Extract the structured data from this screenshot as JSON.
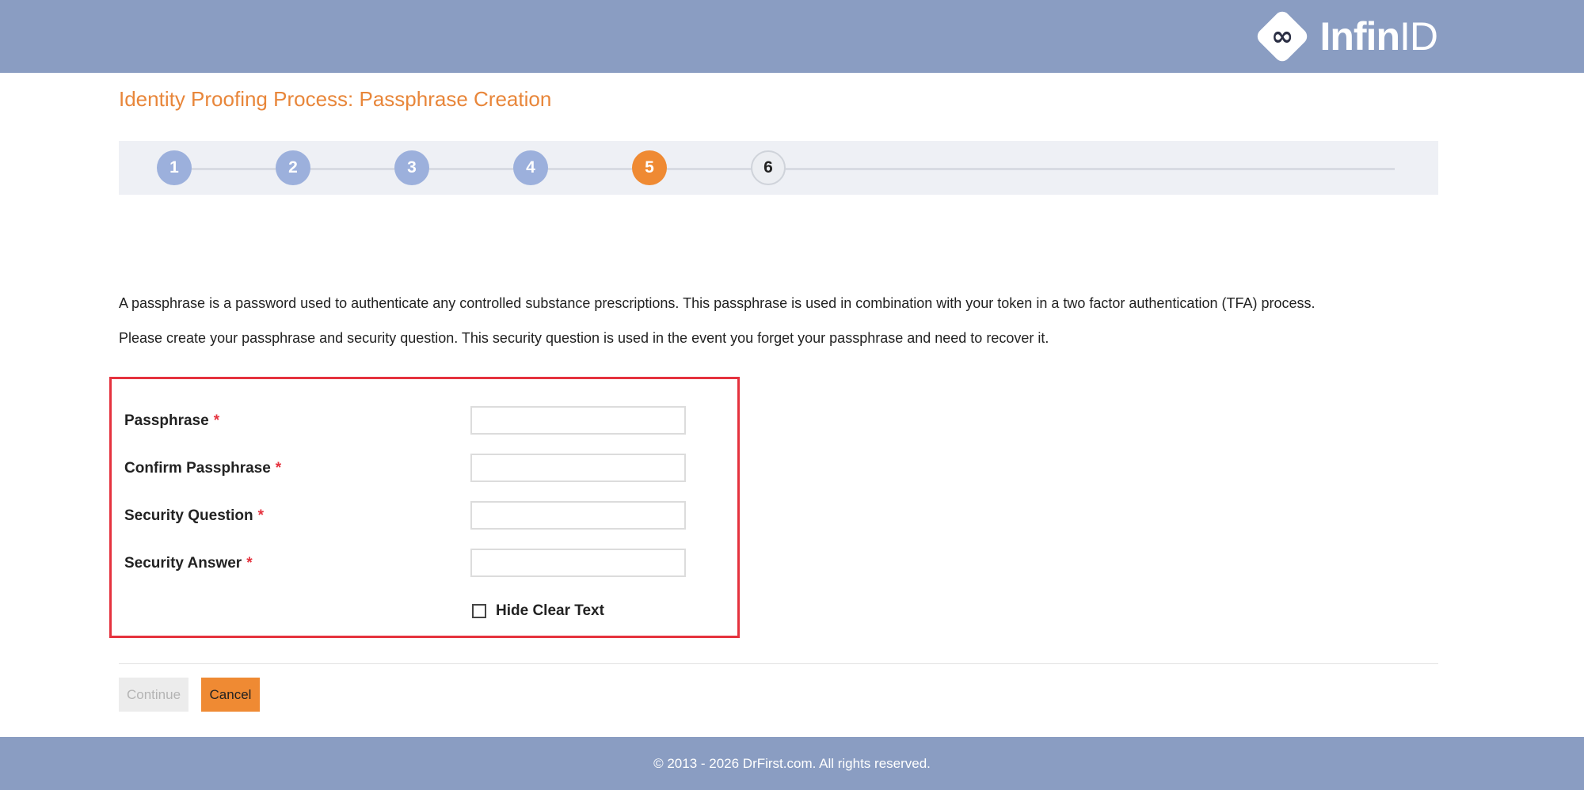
{
  "header": {
    "logo_icon": "infinity-icon",
    "logo_glyph": "∞",
    "logo_text_bold": "Infin",
    "logo_text_light": "ID",
    "bg_color": "#8a9dc2"
  },
  "page": {
    "title": "Identity Proofing Process: Passphrase Creation",
    "accent_color": "#e8863a"
  },
  "stepper": {
    "steps": [
      {
        "label": "1",
        "state": "completed"
      },
      {
        "label": "2",
        "state": "completed"
      },
      {
        "label": "3",
        "state": "completed"
      },
      {
        "label": "4",
        "state": "completed"
      },
      {
        "label": "5",
        "state": "active"
      },
      {
        "label": "6",
        "state": "pending"
      }
    ]
  },
  "intro": {
    "paragraph_1": "A passphrase is a password used to authenticate any controlled substance prescriptions. This passphrase is used in combination with your token in a two factor authentication (TFA) process.",
    "paragraph_2": "Please create your passphrase and security question. This security question is used in the event you forget your passphrase and need to recover it."
  },
  "form": {
    "required_marker": "*",
    "fields": [
      {
        "label": "Passphrase",
        "value": ""
      },
      {
        "label": "Confirm Passphrase",
        "value": ""
      },
      {
        "label": "Security Question",
        "value": ""
      },
      {
        "label": "Security Answer",
        "value": ""
      }
    ],
    "hide_clear_text_label": "Hide Clear Text",
    "hide_clear_text_checked": false
  },
  "actions": {
    "continue_label": "Continue",
    "continue_disabled": true,
    "cancel_label": "Cancel"
  },
  "footer": {
    "copyright": "© 2013 - 2026 DrFirst.com. All rights reserved."
  }
}
